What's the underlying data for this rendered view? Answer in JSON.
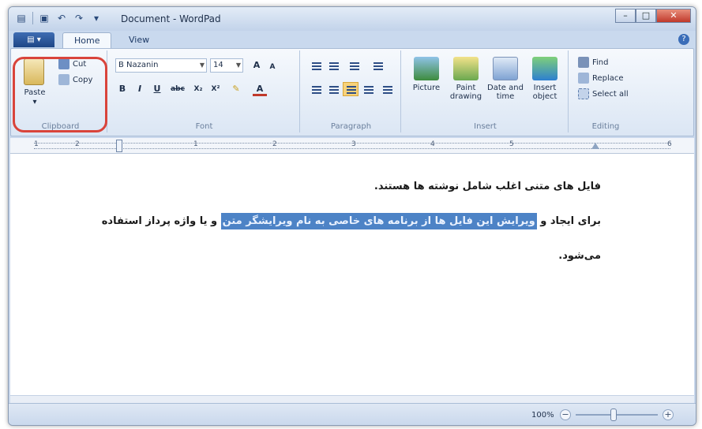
{
  "window": {
    "title": "Document - WordPad",
    "controls": {
      "minimize": "–",
      "maximize": "□",
      "close": "✕"
    }
  },
  "quick_access": [
    "save-icon",
    "undo-icon",
    "redo-icon",
    "customize-icon"
  ],
  "tabs": {
    "app_menu": "▤ ▾",
    "home": "Home",
    "view": "View"
  },
  "ribbon": {
    "clipboard": {
      "label": "Clipboard",
      "paste": "Paste",
      "cut": "Cut",
      "copy": "Copy"
    },
    "font": {
      "label": "Font",
      "family": "B Nazanin",
      "size": "14",
      "grow": "A",
      "shrink": "A",
      "bold": "B",
      "italic": "I",
      "underline": "U",
      "strike": "abc",
      "subscript": "X₂",
      "superscript": "X²",
      "color": "A"
    },
    "paragraph": {
      "label": "Paragraph"
    },
    "insert": {
      "label": "Insert",
      "picture": "Picture",
      "paint": "Paint drawing",
      "datetime": "Date and time",
      "object": "Insert object"
    },
    "editing": {
      "label": "Editing",
      "find": "Find",
      "replace": "Replace",
      "select_all": "Select all"
    }
  },
  "ruler": {
    "numbers": [
      "1",
      "2",
      "1",
      "2",
      "3",
      "4",
      "5",
      "6"
    ]
  },
  "document": {
    "line1": "فایل های متنی اغلب شامل نوشته ها هستند.",
    "line2_before": "برای ایجاد و ",
    "line2_selected": "ویرایش این فایل ها از برنامه های خاصی به نام ویرایشگر متن",
    "line2_after": " و یا واژه پرداز استفاده",
    "line3": "می‌شود."
  },
  "status": {
    "zoom": "100%",
    "zoom_minus": "−",
    "zoom_plus": "+"
  },
  "colors": {
    "accent": "#2e5ea8",
    "selection": "#4d83c6",
    "highlight_ring": "#d9443b"
  }
}
